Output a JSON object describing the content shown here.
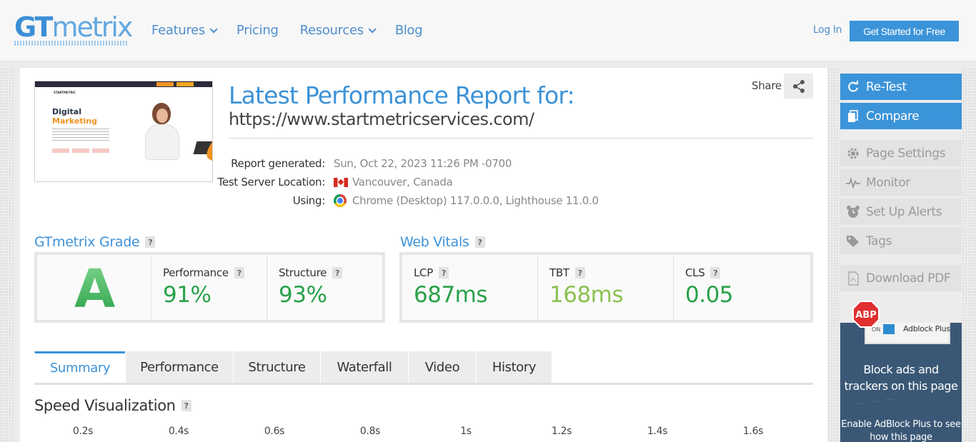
{
  "header": {
    "logo_gt": "GT",
    "logo_metrix": "metrix",
    "nav": [
      {
        "label": "Features",
        "dropdown": true
      },
      {
        "label": "Pricing",
        "dropdown": false
      },
      {
        "label": "Resources",
        "dropdown": true
      },
      {
        "label": "Blog",
        "dropdown": false
      }
    ],
    "login": "Log In",
    "cta": "Get Started for Free"
  },
  "report": {
    "title": "Latest Performance Report for:",
    "url": "https://www.startmetricservices.com/",
    "share_label": "Share",
    "meta": [
      {
        "key": "Report generated:",
        "value": "Sun, Oct 22, 2023 11:26 PM -0700",
        "icon": "none"
      },
      {
        "key": "Test Server Location:",
        "value": "Vancouver, Canada",
        "icon": "canada-flag-icon"
      },
      {
        "key": "Using:",
        "value": "Chrome (Desktop) 117.0.0.0, Lighthouse 11.0.0",
        "icon": "chrome-icon"
      }
    ]
  },
  "thumbnail": {
    "logo": "STARTMETRIC",
    "heading1": "Digital",
    "heading2": "Marketing"
  },
  "grade": {
    "title": "GTmetrix Grade",
    "letter": "A",
    "performance_label": "Performance",
    "performance_value": "91%",
    "structure_label": "Structure",
    "structure_value": "93%"
  },
  "vitals": {
    "title": "Web Vitals",
    "items": [
      {
        "label": "LCP",
        "value": "687ms",
        "color": "#2aa14a"
      },
      {
        "label": "TBT",
        "value": "168ms",
        "color": "#8cc152"
      },
      {
        "label": "CLS",
        "value": "0.05",
        "color": "#2aa14a"
      }
    ]
  },
  "colors": {
    "grade_green": "#2aa14a",
    "accent_blue": "#3b94d9"
  },
  "tabs": [
    {
      "label": "Summary",
      "active": true
    },
    {
      "label": "Performance",
      "active": false
    },
    {
      "label": "Structure",
      "active": false
    },
    {
      "label": "Waterfall",
      "active": false
    },
    {
      "label": "Video",
      "active": false
    },
    {
      "label": "History",
      "active": false
    }
  ],
  "speed": {
    "title": "Speed Visualization",
    "ticks": [
      "0.2s",
      "0.4s",
      "0.6s",
      "0.8s",
      "1s",
      "1.2s",
      "1.4s",
      "1.6s"
    ]
  },
  "sidebar": {
    "buttons": [
      {
        "label": "Re-Test",
        "style": "blue",
        "icon": "refresh-icon"
      },
      {
        "label": "Compare",
        "style": "blue",
        "icon": "compare-icon"
      },
      {
        "label": "Page Settings",
        "style": "gray",
        "icon": "gear-icon"
      },
      {
        "label": "Monitor",
        "style": "gray",
        "icon": "pulse-icon"
      },
      {
        "label": "Set Up Alerts",
        "style": "gray",
        "icon": "alarm-icon"
      },
      {
        "label": "Tags",
        "style": "gray",
        "icon": "tag-icon"
      },
      {
        "label": "Download PDF",
        "style": "gray",
        "icon": "pdf-icon"
      }
    ],
    "ad": {
      "badge": "ABP",
      "toggle": "ON",
      "name": "Adblock Plus",
      "headline": "Block ads and trackers on this page",
      "body": "Enable AdBlock Plus to see how this page"
    }
  }
}
